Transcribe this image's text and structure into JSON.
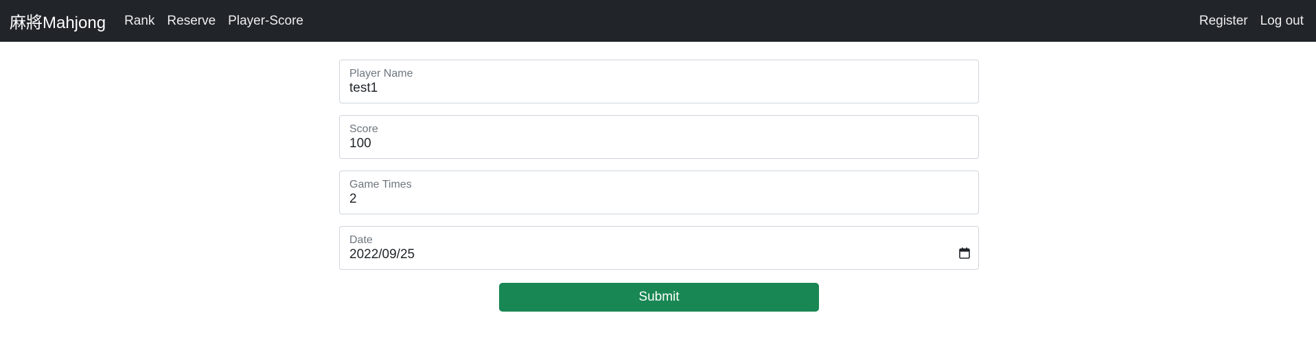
{
  "navbar": {
    "brand": "麻將Mahjong",
    "left_links": [
      {
        "label": "Rank"
      },
      {
        "label": "Reserve"
      },
      {
        "label": "Player-Score"
      }
    ],
    "right_links": [
      {
        "label": "Register"
      },
      {
        "label": "Log out"
      }
    ]
  },
  "form": {
    "fields": [
      {
        "label": "Player Name",
        "value": "test1"
      },
      {
        "label": "Score",
        "value": "100"
      },
      {
        "label": "Game Times",
        "value": "2"
      },
      {
        "label": "Date",
        "value": "2022/09/25",
        "icon": "calendar-icon"
      }
    ],
    "submit_label": "Submit"
  },
  "colors": {
    "navbar_bg": "#212529",
    "submit_bg": "#198754",
    "field_border": "#ced4da",
    "label_text": "#6c757d"
  }
}
